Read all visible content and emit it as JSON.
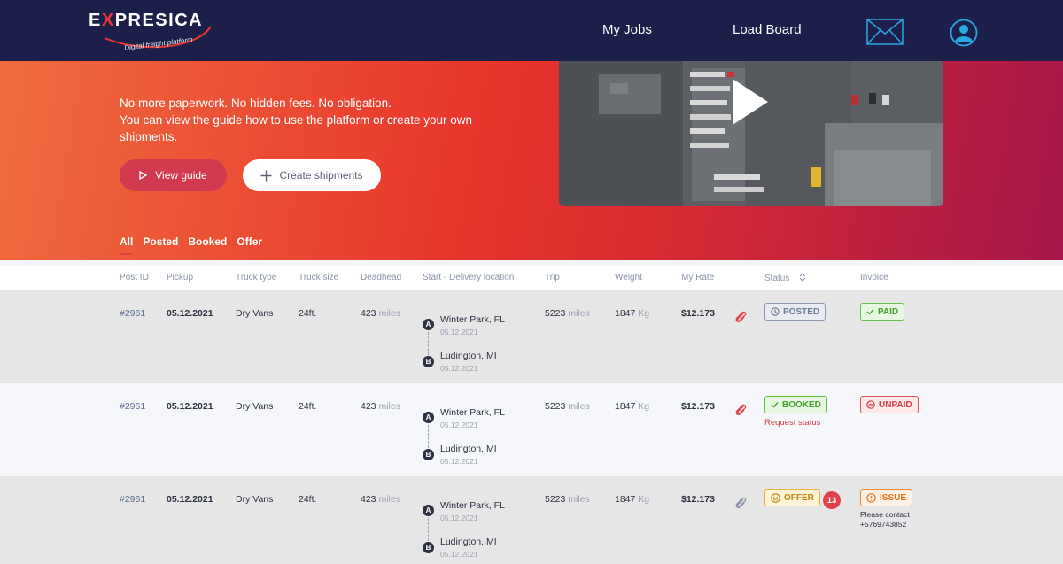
{
  "brand": {
    "name_pre": "E",
    "name_x": "X",
    "name_post": "PRESICA",
    "tagline": "Digital freight platform"
  },
  "nav": {
    "my_jobs": "My Jobs",
    "load_board": "Load Board"
  },
  "hero": {
    "line1": "No more paperwork. No hidden fees. No obligation.",
    "line2": "You can view the guide how to use the platform or create your own shipments.",
    "view_guide": "View guide",
    "create_shipments": "Create shipments"
  },
  "tabs": [
    "All",
    "Posted",
    "Booked",
    "Offer"
  ],
  "columns": {
    "post_id": "Post ID",
    "pickup": "Pickup",
    "truck_type": "Truck type",
    "truck_size": "Truck size",
    "deadhead": "Deadhead",
    "location": "Start - Delivery location",
    "trip": "Trip",
    "weight": "Weight",
    "rate": "My Rate",
    "status": "Status",
    "invoice": "Invoice"
  },
  "rows": [
    {
      "post_id": "#2961",
      "pickup": "05.12.2021",
      "truck_type": "Dry Vans",
      "truck_size": "24ft.",
      "deadhead": "423",
      "deadhead_unit": "miles",
      "pin_a": "A",
      "pin_b": "B",
      "start_city": "Winter Park, FL",
      "start_date": "05.12.2021",
      "end_city": "Ludington, MI",
      "end_date": "05.12.2021",
      "trip": "5223",
      "trip_unit": "miles",
      "weight": "1847",
      "weight_unit": "Kg",
      "rate": "$12.173",
      "status": "POSTED",
      "invoice": "PAID"
    },
    {
      "post_id": "#2961",
      "pickup": "05.12.2021",
      "truck_type": "Dry Vans",
      "truck_size": "24ft.",
      "deadhead": "423",
      "deadhead_unit": "miles",
      "pin_a": "A",
      "pin_b": "B",
      "start_city": "Winter Park, FL",
      "start_date": "05.12.2021",
      "end_city": "Ludington, MI",
      "end_date": "05.12.2021",
      "trip": "5223",
      "trip_unit": "miles",
      "weight": "1847",
      "weight_unit": "Kg",
      "rate": "$12.173",
      "status": "BOOKED",
      "status_note": "Request status",
      "invoice": "UNPAID"
    },
    {
      "post_id": "#2961",
      "pickup": "05.12.2021",
      "truck_type": "Dry Vans",
      "truck_size": "24ft.",
      "deadhead": "423",
      "deadhead_unit": "miles",
      "pin_a": "A",
      "pin_b": "B",
      "start_city": "Winter Park, FL",
      "start_date": "05.12.2021",
      "end_city": "Ludington, MI",
      "end_date": "05.12.2021",
      "trip": "5223",
      "trip_unit": "miles",
      "weight": "1847",
      "weight_unit": "Kg",
      "rate": "$12.173",
      "status": "OFFER",
      "offer_count": "13",
      "invoice": "ISSUE",
      "invoice_note": "Please contact +5769743852"
    }
  ],
  "colors": {
    "nav_bg": "#1c1f4a",
    "accent": "#e8352b",
    "paid": "#44a22a",
    "unpaid": "#d23c47",
    "issue": "#e2761f",
    "offer": "#b98710"
  },
  "icons": {
    "mail": "envelope-icon",
    "profile": "user-icon",
    "play": "play-icon",
    "plus": "plus-icon",
    "attachment": "paperclip-icon",
    "sort": "sort-icon"
  }
}
